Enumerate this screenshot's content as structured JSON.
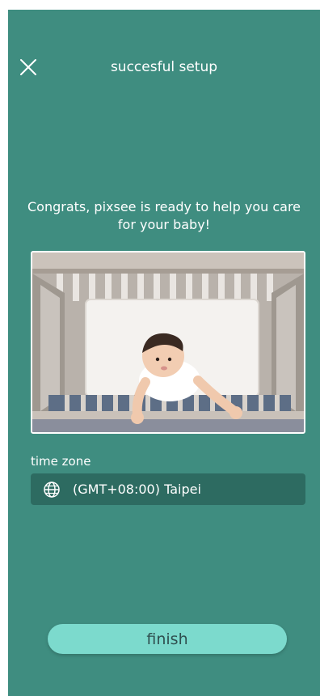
{
  "header": {
    "title": "succesful setup",
    "close_icon": "close-icon"
  },
  "message": "Congrats, pixsee is ready to help you care for your baby!",
  "image": {
    "description_icon": "baby-in-crib-photo"
  },
  "timezone": {
    "label": "time zone",
    "value": "(GMT+08:00) Taipei",
    "icon": "globe-icon"
  },
  "footer": {
    "finish_label": "finish"
  },
  "colors": {
    "background": "#3f8d80",
    "field": "#2d6b61",
    "button": "#7cdacd",
    "button_text": "#2f4f4f"
  }
}
